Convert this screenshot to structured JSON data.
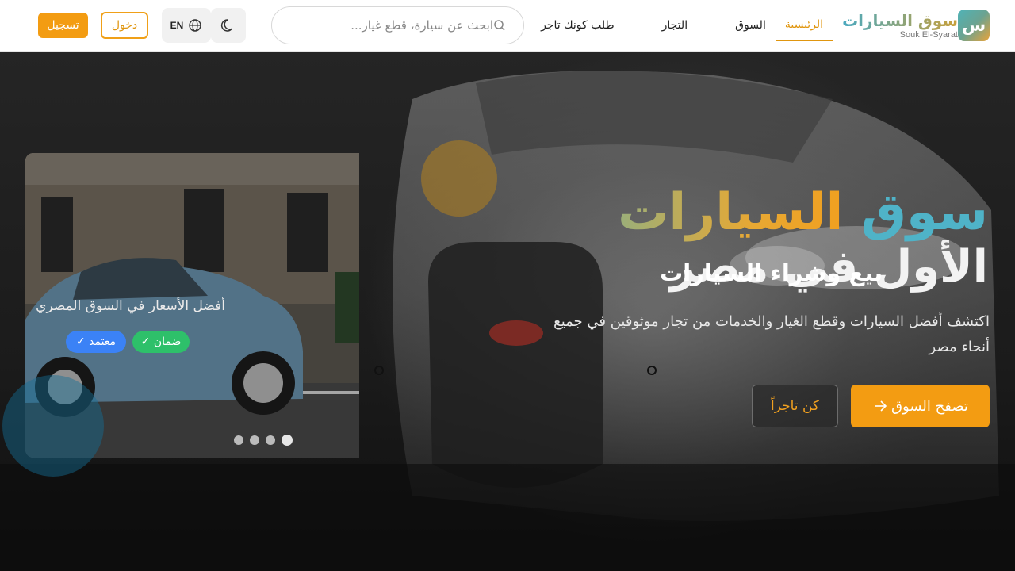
{
  "brand": {
    "logo_letter": "س",
    "name": "سوق السيارات",
    "subtitle": "Souk El-Syarat"
  },
  "nav": {
    "items": [
      {
        "label": "الرئيسية",
        "active": true
      },
      {
        "label": "السوق",
        "active": false
      },
      {
        "label": "التجار",
        "active": false
      },
      {
        "label": "طلب كونك تاجر",
        "active": false
      }
    ]
  },
  "search": {
    "placeholder": "ابحث عن سيارة، قطع غيار...",
    "icon": "search-icon"
  },
  "header_actions": {
    "theme_icon": "moon-icon",
    "language_label": "EN",
    "language_icon": "globe-icon",
    "login_label": "دخول",
    "register_label": "تسجيل"
  },
  "hero": {
    "title_word1": "سوق",
    "title_word2": "السيارات",
    "title_line2": "الأول في مصر",
    "description": "اكتشف أفضل السيارات وقطع الغيار والخدمات من تجار موثوقين في جميع أنحاء مصر",
    "browse_label": "تصفح السوق",
    "browse_icon": "arrow-icon",
    "merchant_label": "كن تاجراً"
  },
  "slider": {
    "title": "بيع وشراء السيارات",
    "subtitle": "أفضل الأسعار في السوق المصري",
    "badges": [
      {
        "label": "ضمان ✓"
      },
      {
        "label": "معتمد ✓"
      }
    ],
    "dots_count": 4,
    "active_dot": 3
  },
  "colors": {
    "accent": "#f39c12",
    "teal": "#4fb3c8",
    "green_badge": "#2ec06a",
    "blue_badge": "#3b82f6"
  }
}
